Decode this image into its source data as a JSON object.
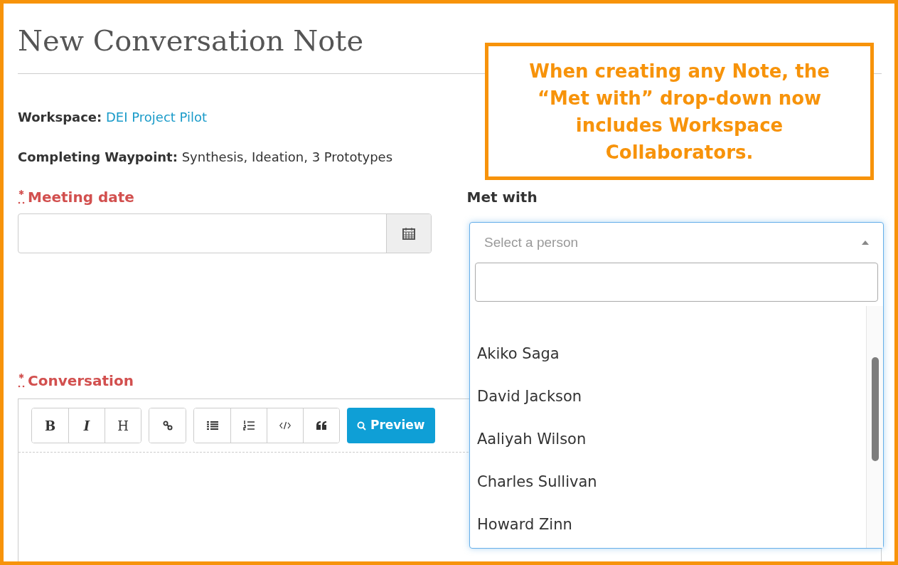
{
  "page_title": "New Conversation Note",
  "callout": {
    "text": "When creating any Note, the “Met with” drop-down now includes Workspace Collaborators."
  },
  "workspace": {
    "label": "Workspace:",
    "value": "DEI Project Pilot"
  },
  "waypoint": {
    "label": "Completing Waypoint:",
    "value": "Synthesis, Ideation, 3 Prototypes"
  },
  "meeting_date": {
    "label": "Meeting date",
    "required": true
  },
  "met_with": {
    "label": "Met with",
    "placeholder": "Select a person",
    "expanded": true,
    "options": [
      {
        "label": "Akiko Saga"
      },
      {
        "label": "David Jackson"
      },
      {
        "label": "Aaliyah Wilson"
      },
      {
        "label": "Charles Sullivan"
      },
      {
        "label": "Howard Zinn"
      }
    ]
  },
  "conversation": {
    "label": "Conversation",
    "required": true,
    "toolbar": [
      {
        "buttons": [
          {
            "kind": "bold",
            "label": "B"
          },
          {
            "kind": "italic",
            "label": "I"
          },
          {
            "kind": "heading",
            "label": "H"
          }
        ]
      },
      {
        "buttons": [
          {
            "kind": "link"
          }
        ]
      },
      {
        "buttons": [
          {
            "kind": "ul"
          },
          {
            "kind": "ol"
          },
          {
            "kind": "code"
          },
          {
            "kind": "quote"
          }
        ]
      }
    ],
    "preview": "Preview"
  }
}
